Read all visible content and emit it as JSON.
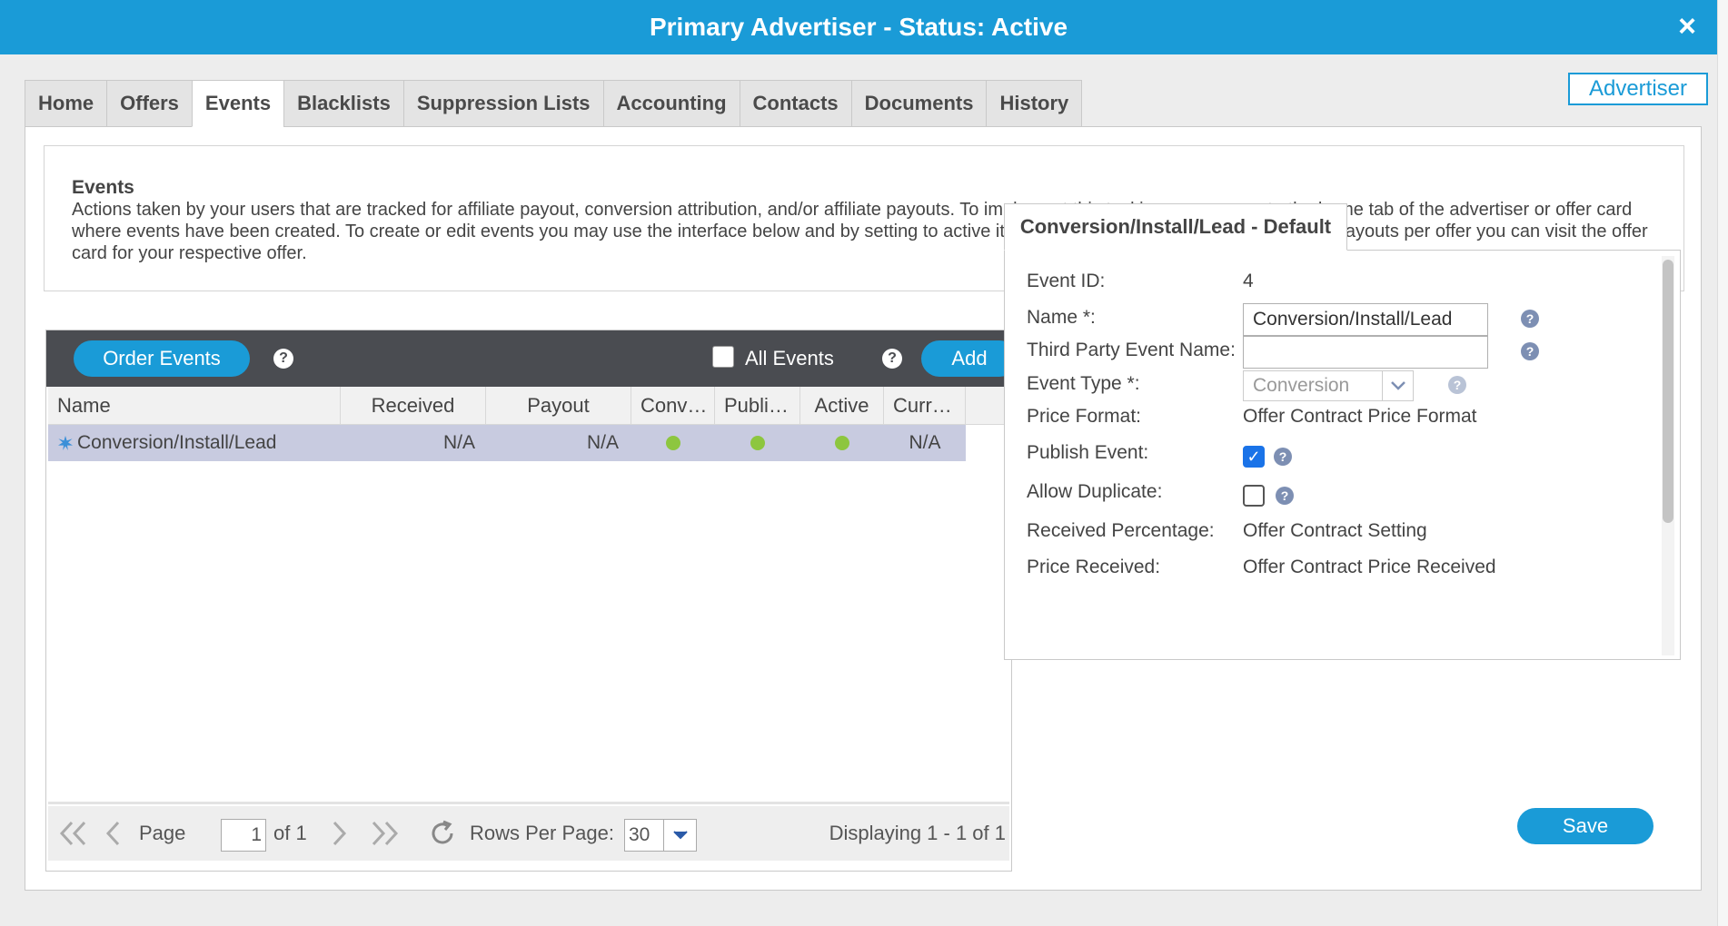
{
  "window": {
    "title": "Primary Advertiser - Status: Active",
    "close_icon": "×"
  },
  "badge": {
    "label": "Advertiser"
  },
  "tabs": [
    {
      "label": "Home"
    },
    {
      "label": "Offers"
    },
    {
      "label": "Events",
      "active": true
    },
    {
      "label": "Blacklists"
    },
    {
      "label": "Suppression Lists"
    },
    {
      "label": "Accounting"
    },
    {
      "label": "Contacts"
    },
    {
      "label": "Documents"
    },
    {
      "label": "History"
    }
  ],
  "info": {
    "title": "Events",
    "text": "Actions taken by your users that are tracked for affiliate payout, conversion attribution, and/or affiliate payouts. To implement this tacking you may go to the home tab of the advertiser or offer card where events have been created. To create or edit events you may use the interface below and by setting to active it will be available to all offers. To override payouts per offer you can visit the offer card for your respective offer."
  },
  "grid": {
    "order_button": "Order Events",
    "help_icon": "?",
    "all_events_label": "All Events",
    "all_events_checked": false,
    "add_button": "Add",
    "columns": [
      "Name",
      "Received",
      "Payout",
      "Conv…",
      "Publi…",
      "Active",
      "Curr…"
    ],
    "rows": [
      {
        "icon": "star-icon",
        "name": "Conversion/Install/Lead",
        "received": "N/A",
        "payout": "N/A",
        "conversion": true,
        "published": true,
        "active": true,
        "currency": "N/A"
      }
    ],
    "pager": {
      "page_label": "Page",
      "page_value": "1",
      "of_label": "of 1",
      "rows_per_page_label": "Rows Per Page:",
      "rows_per_page_value": "30",
      "displaying": "Displaying 1 - 1 of 1"
    }
  },
  "detail": {
    "tab_label": "Conversion/Install/Lead - Default",
    "fields": {
      "event_id_label": "Event ID:",
      "event_id_value": "4",
      "name_label": "Name *:",
      "name_value": "Conversion/Install/Lead",
      "third_party_label": "Third Party Event Name:",
      "third_party_value": "",
      "event_type_label": "Event Type *:",
      "event_type_value": "Conversion",
      "price_format_label": "Price Format:",
      "price_format_value": "Offer Contract Price Format",
      "publish_label": "Publish Event:",
      "publish_checked": true,
      "duplicate_label": "Allow Duplicate:",
      "duplicate_checked": false,
      "received_pct_label": "Received Percentage:",
      "received_pct_value": "Offer Contract Setting",
      "price_received_label": "Price Received:",
      "price_received_value": "Offer Contract Price Received"
    },
    "save_button": "Save"
  },
  "colors": {
    "accent": "#1a9bd7",
    "toolbar": "#4a4c51",
    "selected_row": "#c8cbe0",
    "status_green": "#8dc63f"
  }
}
